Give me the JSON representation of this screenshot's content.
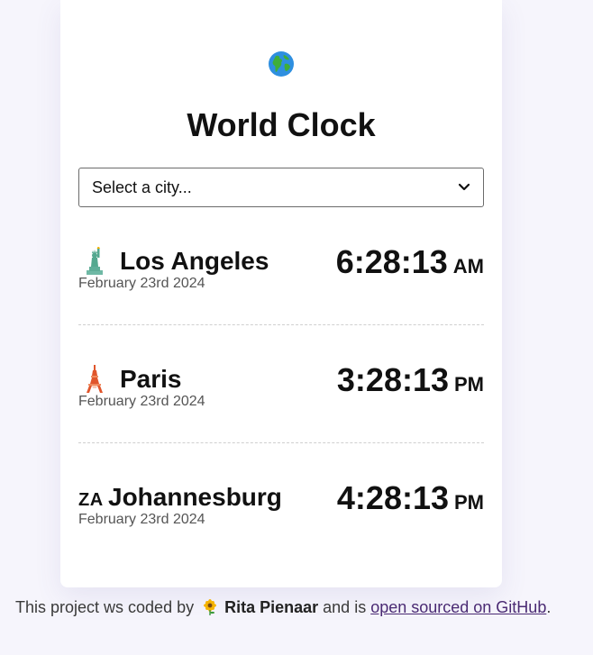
{
  "app": {
    "title": "World Clock",
    "globe_icon": "globe-icon"
  },
  "select": {
    "value": "Select a city...",
    "icon": "chevron-down-icon"
  },
  "cities": [
    {
      "icon": "statue-of-liberty-icon",
      "name": "Los Angeles",
      "date": "February 23rd 2024",
      "time": "6:28:13",
      "ampm": "AM"
    },
    {
      "icon": "tokyo-tower-icon",
      "name": "Paris",
      "date": "February 23rd 2024",
      "time": "3:28:13",
      "ampm": "PM"
    },
    {
      "flag": "ZA",
      "name": "Johannesburg",
      "date": "February 23rd 2024",
      "time": "4:28:13",
      "ampm": "PM"
    }
  ],
  "footer": {
    "prefix": "This project ws coded by ",
    "icon": "sunflower-icon",
    "author": "Rita Pienaar",
    "middle": " and is ",
    "link": "open sourced on GitHub",
    "suffix": "."
  }
}
